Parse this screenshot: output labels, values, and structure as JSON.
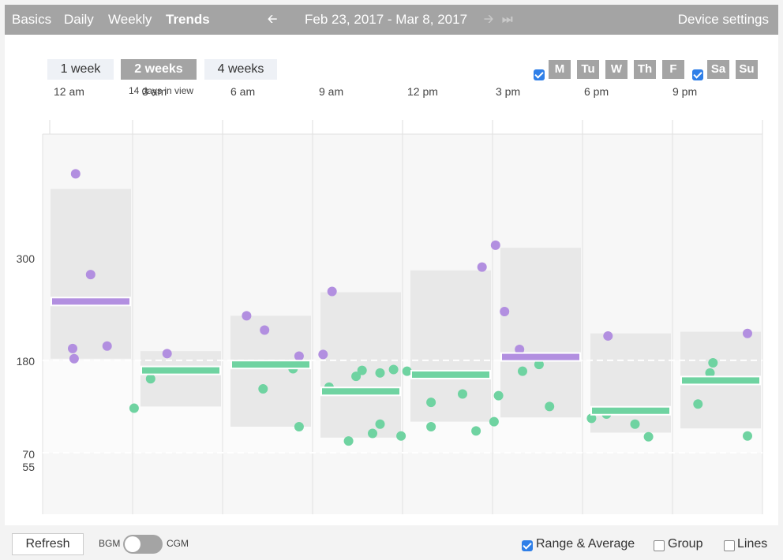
{
  "nav": {
    "basics": "Basics",
    "daily": "Daily",
    "weekly": "Weekly",
    "trends": "Trends",
    "date_range": "Feb 23, 2017 - Mar 8, 2017",
    "device_settings": "Device settings",
    "prev_icon": "arrow-left-icon",
    "next_icon": "arrow-right-icon",
    "last_icon": "skip-to-end-icon"
  },
  "range": {
    "one_week": "1 week",
    "two_weeks": "2 weeks",
    "four_weeks": "4 weeks",
    "selected": "2 weeks",
    "days_in_view": "14 days in view"
  },
  "days": {
    "weekday_all_checked": true,
    "weekend_all_checked": true,
    "items": [
      {
        "label": "M",
        "active": true
      },
      {
        "label": "Tu",
        "active": true
      },
      {
        "label": "W",
        "active": true
      },
      {
        "label": "Th",
        "active": true
      },
      {
        "label": "F",
        "active": true
      },
      {
        "label": "Sa",
        "active": true
      },
      {
        "label": "Su",
        "active": true
      }
    ]
  },
  "colors": {
    "bar_gray": "#a4a4a4",
    "purple": "#b28fe0",
    "green": "#6fd3a1",
    "range_box": "#e8e8e8",
    "checkbox": "#2f7fe8"
  },
  "chart_data": {
    "type": "scatter",
    "x_unit": "hour of day",
    "xlim": [
      0,
      24
    ],
    "x_tick_labels": [
      "12 am",
      "3 am",
      "6 am",
      "9 am",
      "12 pm",
      "3 pm",
      "6 pm",
      "9 pm"
    ],
    "y_ticks": [
      55,
      70,
      180,
      300
    ],
    "target_range": [
      70,
      180
    ],
    "bins": [
      {
        "hour_start": 0,
        "min": 182,
        "max": 384,
        "mean": 250,
        "avg_color": "purple"
      },
      {
        "hour_start": 3,
        "min": 125,
        "max": 191,
        "mean": 168,
        "avg_color": "green"
      },
      {
        "hour_start": 6,
        "min": 101,
        "max": 233,
        "mean": 175,
        "avg_color": "green"
      },
      {
        "hour_start": 9,
        "min": 88,
        "max": 261,
        "mean": 143,
        "avg_color": "green"
      },
      {
        "hour_start": 12,
        "min": 107,
        "max": 287,
        "mean": 163,
        "avg_color": "green"
      },
      {
        "hour_start": 15,
        "min": 112,
        "max": 314,
        "mean": 184,
        "avg_color": "purple"
      },
      {
        "hour_start": 18,
        "min": 94,
        "max": 212,
        "mean": 120,
        "avg_color": "green"
      },
      {
        "hour_start": 21,
        "min": 99,
        "max": 214,
        "mean": 156,
        "avg_color": "green"
      }
    ],
    "points": [
      {
        "x": 1.1,
        "y": 402,
        "c": "purple"
      },
      {
        "x": 1.6,
        "y": 282,
        "c": "purple"
      },
      {
        "x": 1.0,
        "y": 194,
        "c": "purple"
      },
      {
        "x": 1.05,
        "y": 182,
        "c": "purple"
      },
      {
        "x": 2.15,
        "y": 197,
        "c": "purple"
      },
      {
        "x": 3.05,
        "y": 123,
        "c": "green"
      },
      {
        "x": 3.6,
        "y": 158,
        "c": "green"
      },
      {
        "x": 4.15,
        "y": 188,
        "c": "purple"
      },
      {
        "x": 6.8,
        "y": 233,
        "c": "purple"
      },
      {
        "x": 7.4,
        "y": 216,
        "c": "purple"
      },
      {
        "x": 7.35,
        "y": 146,
        "c": "green"
      },
      {
        "x": 8.35,
        "y": 170,
        "c": "green"
      },
      {
        "x": 8.55,
        "y": 185,
        "c": "purple"
      },
      {
        "x": 8.55,
        "y": 101,
        "c": "green"
      },
      {
        "x": 9.35,
        "y": 187,
        "c": "purple"
      },
      {
        "x": 9.65,
        "y": 262,
        "c": "purple"
      },
      {
        "x": 9.55,
        "y": 148,
        "c": "green"
      },
      {
        "x": 10.2,
        "y": 84,
        "c": "green"
      },
      {
        "x": 10.45,
        "y": 161,
        "c": "green"
      },
      {
        "x": 10.65,
        "y": 168,
        "c": "green"
      },
      {
        "x": 11.25,
        "y": 165,
        "c": "green"
      },
      {
        "x": 11.7,
        "y": 169,
        "c": "green"
      },
      {
        "x": 11.0,
        "y": 93,
        "c": "green"
      },
      {
        "x": 11.25,
        "y": 104,
        "c": "green"
      },
      {
        "x": 11.95,
        "y": 90,
        "c": "green"
      },
      {
        "x": 12.15,
        "y": 167,
        "c": "green"
      },
      {
        "x": 12.5,
        "y": 163,
        "c": "green"
      },
      {
        "x": 12.95,
        "y": 130,
        "c": "green"
      },
      {
        "x": 12.95,
        "y": 101,
        "c": "green"
      },
      {
        "x": 14.0,
        "y": 140,
        "c": "green"
      },
      {
        "x": 14.45,
        "y": 96,
        "c": "green"
      },
      {
        "x": 14.65,
        "y": 291,
        "c": "purple"
      },
      {
        "x": 15.05,
        "y": 107,
        "c": "green"
      },
      {
        "x": 15.1,
        "y": 317,
        "c": "purple"
      },
      {
        "x": 15.4,
        "y": 238,
        "c": "purple"
      },
      {
        "x": 15.2,
        "y": 138,
        "c": "green"
      },
      {
        "x": 15.9,
        "y": 193,
        "c": "purple"
      },
      {
        "x": 16.0,
        "y": 167,
        "c": "green"
      },
      {
        "x": 16.55,
        "y": 175,
        "c": "green"
      },
      {
        "x": 16.9,
        "y": 125,
        "c": "green"
      },
      {
        "x": 18.3,
        "y": 111,
        "c": "green"
      },
      {
        "x": 18.8,
        "y": 116,
        "c": "green"
      },
      {
        "x": 18.85,
        "y": 209,
        "c": "purple"
      },
      {
        "x": 19.75,
        "y": 104,
        "c": "green"
      },
      {
        "x": 20.2,
        "y": 89,
        "c": "green"
      },
      {
        "x": 21.85,
        "y": 128,
        "c": "green"
      },
      {
        "x": 22.25,
        "y": 165,
        "c": "green"
      },
      {
        "x": 22.35,
        "y": 177,
        "c": "green"
      },
      {
        "x": 23.5,
        "y": 212,
        "c": "purple"
      },
      {
        "x": 23.5,
        "y": 90,
        "c": "green"
      }
    ]
  },
  "footer": {
    "refresh": "Refresh",
    "bgm": "BGM",
    "cgm": "CGM",
    "range_avg": "Range & Average",
    "range_avg_checked": true,
    "group": "Group",
    "group_checked": false,
    "lines": "Lines",
    "lines_checked": false
  }
}
